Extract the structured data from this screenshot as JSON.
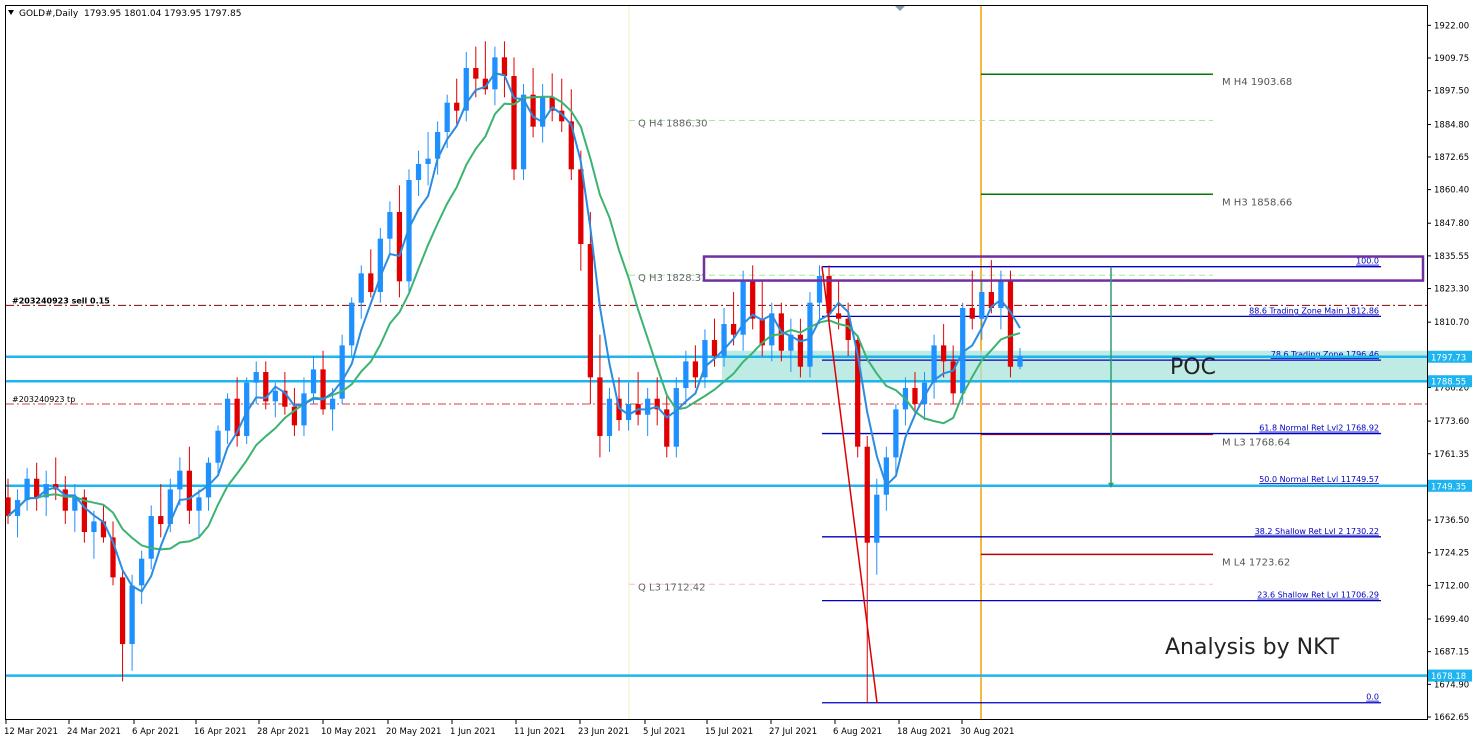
{
  "header": {
    "symbol": "GOLD#,Daily",
    "ohlc": "1793.95 1801.04 1793.95 1797.85"
  },
  "chart_data": {
    "type": "candlestick",
    "ylim": [
      1662.65,
      1928.5
    ],
    "y_ticks": [
      "1922.00",
      "1909.75",
      "1897.50",
      "1884.80",
      "1872.65",
      "1860.40",
      "1847.80",
      "1835.55",
      "1823.30",
      "1810.70",
      "1798.45",
      "1786.20",
      "1773.60",
      "1761.35",
      "1749.10",
      "1736.50",
      "1724.25",
      "1712.00",
      "1699.40",
      "1687.15",
      "1674.90",
      "1662.65"
    ],
    "x_ticks": [
      "12 Mar 2021",
      "24 Mar 2021",
      "6 Apr 2021",
      "16 Apr 2021",
      "28 Apr 2021",
      "10 May 2021",
      "20 May 2021",
      "1 Jun 2021",
      "11 Jun 2021",
      "23 Jun 2021",
      "5 Jul 2021",
      "15 Jul 2021",
      "27 Jul 2021",
      "6 Aug 2021",
      "18 Aug 2021",
      "30 Aug 2021"
    ],
    "price_tags": [
      {
        "label": "1797.73",
        "value": 1797.73
      },
      {
        "label": "1788.55",
        "value": 1788.55
      },
      {
        "label": "1749.35",
        "value": 1749.35
      },
      {
        "label": "1678.18",
        "value": 1678.18
      }
    ],
    "order_lines": [
      {
        "label": "#203240923 sell 0.15",
        "value": 1817.0
      },
      {
        "label": "#203240923 tp",
        "value": 1780.0
      }
    ],
    "q_pivots": [
      {
        "label": "Q  H4 1886.30",
        "value": 1886.3
      },
      {
        "label": "Q  H3 1828.31",
        "value": 1828.31
      },
      {
        "label": "Q  L3 1712.42",
        "value": 1712.42
      }
    ],
    "m_pivots": [
      {
        "label": "M  H4 1903.68",
        "value": 1903.68,
        "color": "#007a00"
      },
      {
        "label": "M  H3 1858.66",
        "value": 1858.66,
        "color": "#007a00"
      },
      {
        "label": "M  L3 1768.64",
        "value": 1768.64,
        "color": "#c00000"
      },
      {
        "label": "M  L4 1723.62",
        "value": 1723.62,
        "color": "#c00000"
      }
    ],
    "fib_levels": [
      {
        "label": "100.0",
        "value": 1831.5
      },
      {
        "label": "88.6 Trading Zone Main 1812.86",
        "value": 1812.86
      },
      {
        "label": "78.6 Trading Zone 1796.46",
        "value": 1796.46
      },
      {
        "label": "61.8 Normal Ret Lvl2 1768.92",
        "value": 1768.92
      },
      {
        "label": "50.0 Normal Ret Lvl 11749.57",
        "value": 1749.57
      },
      {
        "label": "38.2 Shallow Ret Lvl 2 1730.22",
        "value": 1730.22
      },
      {
        "label": "23.6 Shallow Ret Lvl 11706.29",
        "value": 1706.29
      },
      {
        "label": "0.0",
        "value": 1668.0
      }
    ],
    "candles": [
      [
        1745,
        1752,
        1735,
        1738
      ],
      [
        1738,
        1748,
        1730,
        1744
      ],
      [
        1744,
        1756,
        1740,
        1752
      ],
      [
        1752,
        1758,
        1740,
        1745
      ],
      [
        1745,
        1755,
        1738,
        1750
      ],
      [
        1750,
        1760,
        1744,
        1748
      ],
      [
        1748,
        1753,
        1735,
        1740
      ],
      [
        1740,
        1750,
        1732,
        1745
      ],
      [
        1745,
        1748,
        1728,
        1732
      ],
      [
        1732,
        1740,
        1722,
        1736
      ],
      [
        1736,
        1742,
        1728,
        1730
      ],
      [
        1730,
        1736,
        1712,
        1715
      ],
      [
        1715,
        1718,
        1676,
        1690
      ],
      [
        1690,
        1716,
        1680,
        1712
      ],
      [
        1712,
        1725,
        1705,
        1722
      ],
      [
        1722,
        1742,
        1718,
        1738
      ],
      [
        1738,
        1750,
        1730,
        1735
      ],
      [
        1735,
        1752,
        1732,
        1748
      ],
      [
        1748,
        1760,
        1742,
        1755
      ],
      [
        1755,
        1764,
        1735,
        1740
      ],
      [
        1740,
        1748,
        1730,
        1745
      ],
      [
        1745,
        1760,
        1740,
        1758
      ],
      [
        1758,
        1772,
        1754,
        1770
      ],
      [
        1770,
        1784,
        1765,
        1782
      ],
      [
        1782,
        1790,
        1764,
        1768
      ],
      [
        1768,
        1790,
        1765,
        1788
      ],
      [
        1788,
        1796,
        1780,
        1792
      ],
      [
        1792,
        1796,
        1778,
        1781
      ],
      [
        1781,
        1788,
        1775,
        1785
      ],
      [
        1785,
        1792,
        1776,
        1779
      ],
      [
        1779,
        1786,
        1768,
        1772
      ],
      [
        1772,
        1790,
        1768,
        1784
      ],
      [
        1784,
        1798,
        1780,
        1793
      ],
      [
        1793,
        1800,
        1776,
        1778
      ],
      [
        1778,
        1786,
        1770,
        1782
      ],
      [
        1782,
        1806,
        1780,
        1802
      ],
      [
        1802,
        1820,
        1798,
        1818
      ],
      [
        1818,
        1832,
        1812,
        1829
      ],
      [
        1829,
        1838,
        1820,
        1822
      ],
      [
        1822,
        1846,
        1818,
        1842
      ],
      [
        1842,
        1856,
        1836,
        1852
      ],
      [
        1852,
        1862,
        1820,
        1826
      ],
      [
        1826,
        1868,
        1822,
        1864
      ],
      [
        1864,
        1875,
        1858,
        1870
      ],
      [
        1870,
        1882,
        1862,
        1872
      ],
      [
        1872,
        1886,
        1866,
        1882
      ],
      [
        1882,
        1896,
        1876,
        1893
      ],
      [
        1893,
        1902,
        1885,
        1890
      ],
      [
        1890,
        1912,
        1886,
        1906
      ],
      [
        1906,
        1914,
        1895,
        1902
      ],
      [
        1902,
        1916,
        1896,
        1898
      ],
      [
        1898,
        1914,
        1892,
        1910
      ],
      [
        1910,
        1916,
        1895,
        1903
      ],
      [
        1903,
        1910,
        1864,
        1868
      ],
      [
        1868,
        1900,
        1864,
        1896
      ],
      [
        1896,
        1906,
        1880,
        1884
      ],
      [
        1884,
        1900,
        1878,
        1895
      ],
      [
        1895,
        1904,
        1886,
        1890
      ],
      [
        1890,
        1902,
        1882,
        1886
      ],
      [
        1886,
        1898,
        1864,
        1868
      ],
      [
        1868,
        1875,
        1830,
        1840
      ],
      [
        1840,
        1852,
        1780,
        1790
      ],
      [
        1790,
        1806,
        1760,
        1768
      ],
      [
        1768,
        1786,
        1762,
        1782
      ],
      [
        1782,
        1790,
        1770,
        1774
      ],
      [
        1774,
        1788,
        1770,
        1780
      ],
      [
        1780,
        1792,
        1772,
        1776
      ],
      [
        1776,
        1786,
        1768,
        1782
      ],
      [
        1782,
        1790,
        1772,
        1778
      ],
      [
        1778,
        1784,
        1760,
        1764
      ],
      [
        1764,
        1790,
        1760,
        1786
      ],
      [
        1786,
        1800,
        1780,
        1796
      ],
      [
        1796,
        1802,
        1786,
        1790
      ],
      [
        1790,
        1808,
        1786,
        1804
      ],
      [
        1804,
        1812,
        1794,
        1798
      ],
      [
        1798,
        1816,
        1794,
        1810
      ],
      [
        1810,
        1822,
        1802,
        1806
      ],
      [
        1806,
        1830,
        1800,
        1826
      ],
      [
        1826,
        1832,
        1808,
        1812
      ],
      [
        1812,
        1826,
        1798,
        1802
      ],
      [
        1802,
        1818,
        1796,
        1814
      ],
      [
        1814,
        1818,
        1796,
        1800
      ],
      [
        1800,
        1812,
        1792,
        1806
      ],
      [
        1806,
        1812,
        1790,
        1794
      ],
      [
        1794,
        1822,
        1790,
        1818
      ],
      [
        1818,
        1832,
        1810,
        1828
      ],
      [
        1828,
        1832,
        1810,
        1814
      ],
      [
        1814,
        1826,
        1808,
        1812
      ],
      [
        1812,
        1818,
        1798,
        1804
      ],
      [
        1804,
        1806,
        1760,
        1764
      ],
      [
        1764,
        1768,
        1668,
        1728
      ],
      [
        1728,
        1752,
        1716,
        1746
      ],
      [
        1746,
        1764,
        1740,
        1760
      ],
      [
        1760,
        1780,
        1754,
        1778
      ],
      [
        1778,
        1790,
        1772,
        1786
      ],
      [
        1786,
        1792,
        1776,
        1780
      ],
      [
        1780,
        1792,
        1774,
        1788
      ],
      [
        1788,
        1806,
        1782,
        1802
      ],
      [
        1802,
        1810,
        1790,
        1796
      ],
      [
        1796,
        1802,
        1780,
        1784
      ],
      [
        1784,
        1818,
        1780,
        1816
      ],
      [
        1816,
        1830,
        1808,
        1812
      ],
      [
        1812,
        1826,
        1804,
        1822
      ],
      [
        1822,
        1834,
        1814,
        1816
      ],
      [
        1816,
        1830,
        1808,
        1826
      ],
      [
        1826,
        1830,
        1790,
        1794
      ],
      [
        1794,
        1801,
        1793,
        1798
      ]
    ],
    "annotations": {
      "poc": "POC",
      "credit": "Analysis by NKT"
    }
  }
}
